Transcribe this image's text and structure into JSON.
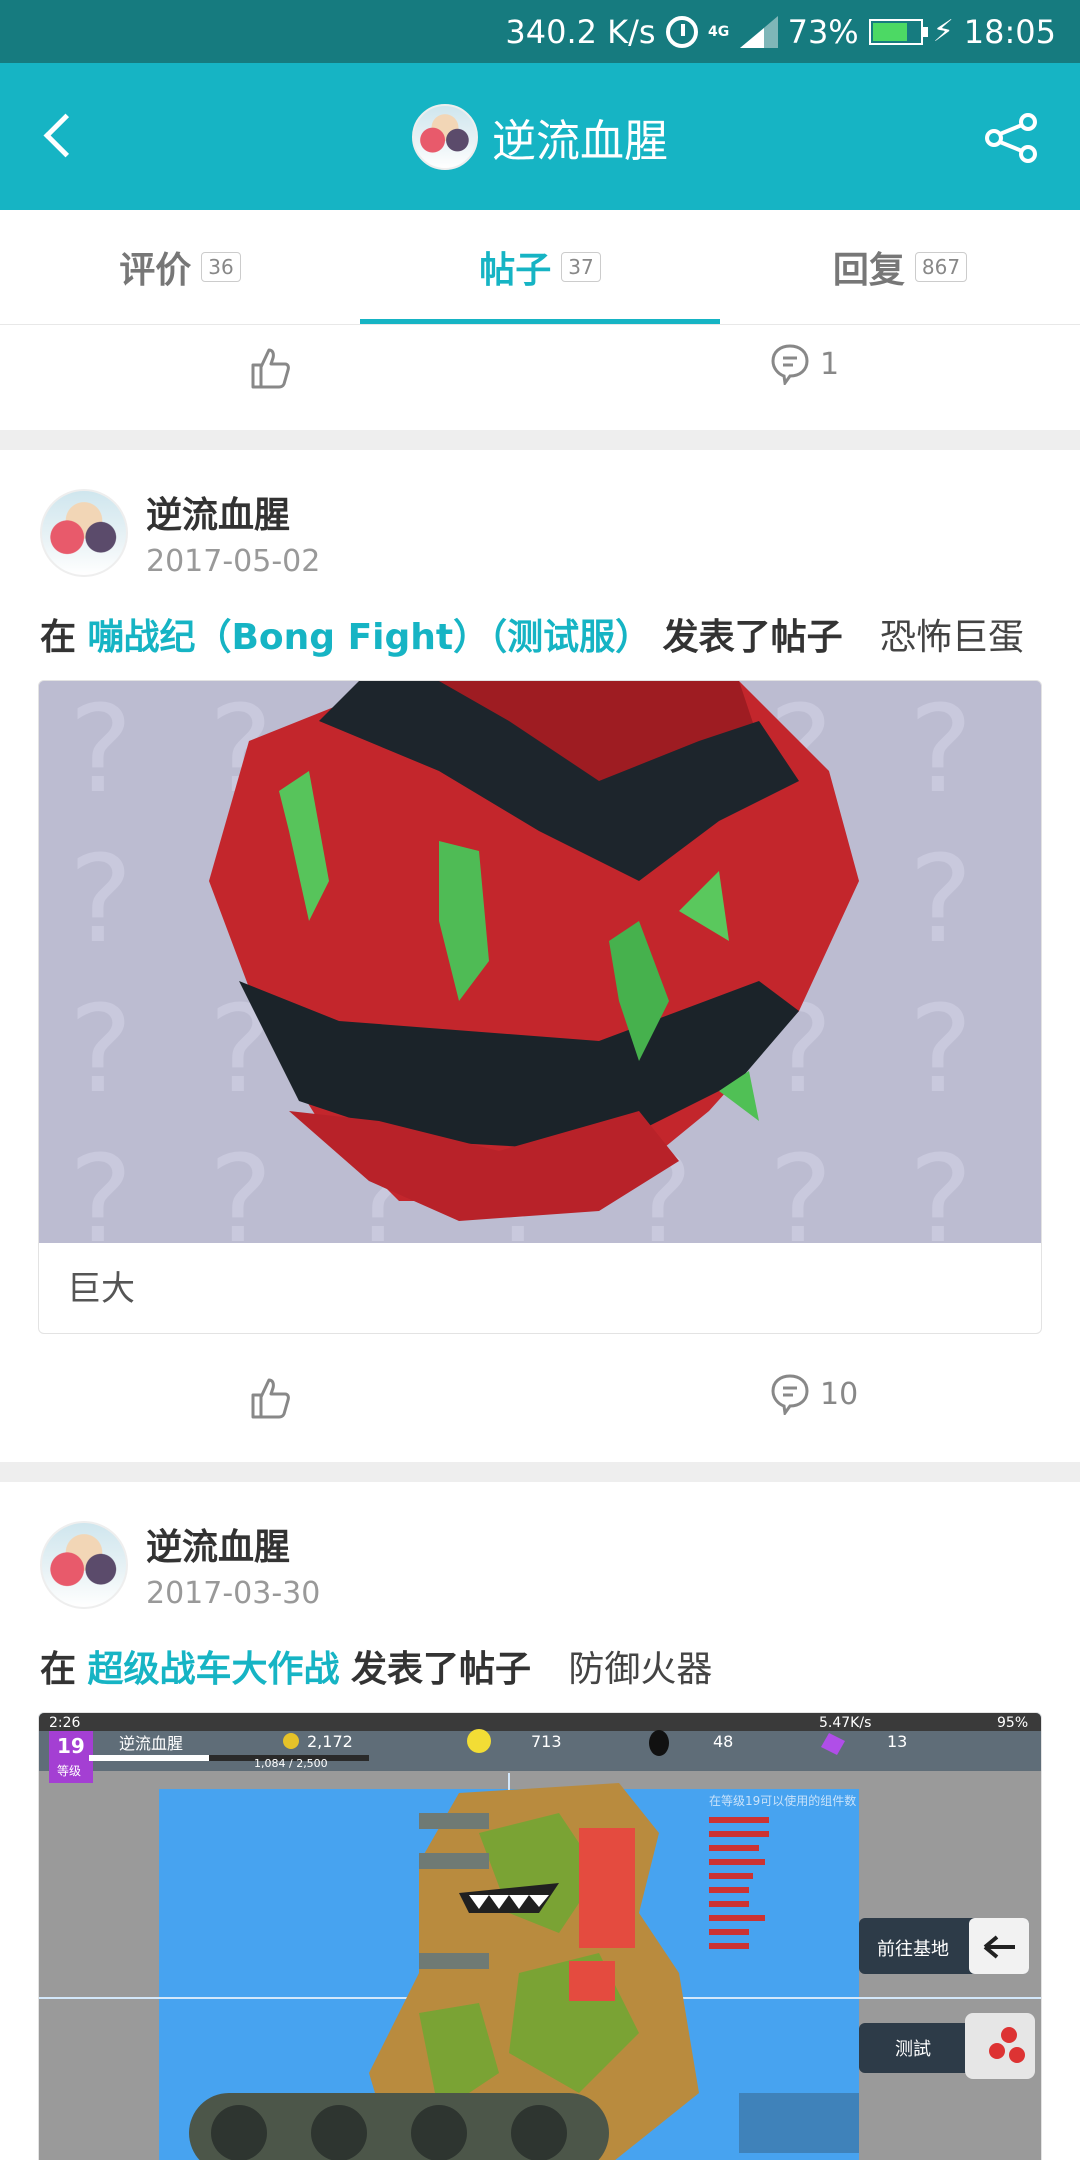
{
  "status_bar": {
    "speed": "340.2 K/s",
    "network": "4G",
    "battery": "73%",
    "battery_level": 0.73,
    "time": "18:05"
  },
  "header": {
    "title": "逆流血腥"
  },
  "tabs": [
    {
      "label": "评价",
      "count": "36"
    },
    {
      "label": "帖子",
      "count": "37",
      "active": true
    },
    {
      "label": "回复",
      "count": "867"
    }
  ],
  "feed": {
    "top_row": {
      "comments": "1"
    },
    "posts": [
      {
        "user": "逆流血腥",
        "date": "2017-05-02",
        "prefix": "在",
        "game": "嘣战纪（Bong Fight）（测试服）",
        "verb": "发表了帖子",
        "title": "恐怖巨蛋",
        "caption": "巨大",
        "comments": "10"
      },
      {
        "user": "逆流血腥",
        "date": "2017-03-30",
        "prefix": "在",
        "game": "超级战车大作战",
        "verb": "发表了帖子",
        "title": "防御火器"
      }
    ]
  },
  "screenshot_overlay": {
    "time": "2:26",
    "speed": "5.47K/s",
    "battery": "95%",
    "level": "19",
    "level_label": "等级",
    "player": "逆流血腥",
    "coins": "2,172",
    "xp": "1,084 / 2,500",
    "gold": "713",
    "oil": "48",
    "gems": "13",
    "info": "在等级19可以使用的组件数",
    "btn_base": "前往基地",
    "btn_test": "测試"
  }
}
